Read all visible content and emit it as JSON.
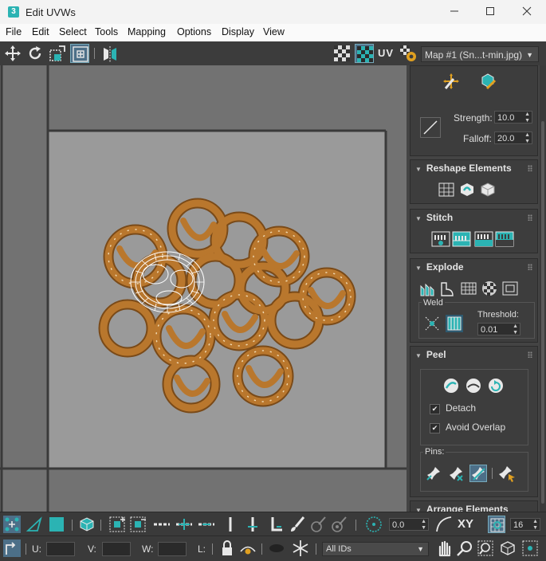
{
  "window": {
    "title": "Edit UVWs",
    "logo": "3",
    "controls": [
      "minimize-icon",
      "maximize-icon",
      "close-icon"
    ]
  },
  "menu": [
    "File",
    "Edit",
    "Select",
    "Tools",
    "Mapping",
    "Options",
    "Display",
    "View"
  ],
  "toolbar": {
    "uv_label": "UV",
    "map_selector": "Map #1 (Sn...t-min.jpg)",
    "tools": [
      "move-icon",
      "rotate-icon",
      "scale-icon",
      "freeform-icon",
      "mirror-icon"
    ],
    "checker_icons": [
      "checker-pattern-icon",
      "checker-texture-icon"
    ],
    "settings_icon": "uv-settings-icon"
  },
  "panel": {
    "brush": {
      "strength_label": "Strength:",
      "strength_value": "10.0",
      "falloff_label": "Falloff:",
      "falloff_value": "20.0"
    },
    "reshape": {
      "title": "Reshape Elements"
    },
    "stitch": {
      "title": "Stitch"
    },
    "explode": {
      "title": "Explode",
      "weld_label": "Weld",
      "threshold_label": "Threshold:",
      "threshold_value": "0.01"
    },
    "peel": {
      "title": "Peel",
      "detach_label": "Detach",
      "avoid_overlap_label": "Avoid Overlap",
      "detach_checked": true,
      "avoid_overlap_checked": true,
      "pins_label": "Pins:"
    },
    "arrange": {
      "title": "Arrange Elements"
    }
  },
  "bottom": {
    "angle_value": "0.0",
    "xy_label": "XY",
    "grid_value": "16",
    "u_label": "U:",
    "v_label": "V:",
    "w_label": "W:",
    "l_label": "L:",
    "ids_select": "All IDs"
  },
  "colors": {
    "accent": "#2bb3b3",
    "viewport_bg": "#727272",
    "canvas_bg": "#9a9a9a",
    "pretzel": "#b9772d",
    "mesh": "#ffffff"
  }
}
